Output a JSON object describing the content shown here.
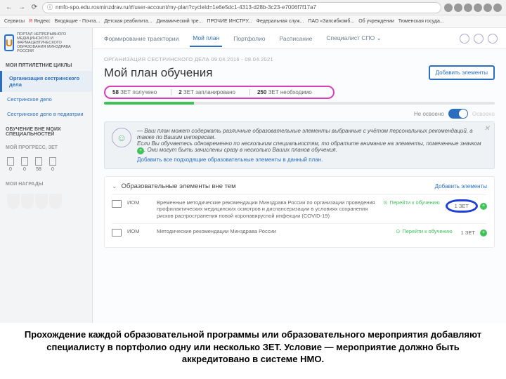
{
  "browser": {
    "url": "nmfo-spo.edu.rosminzdrav.ru/#/user-account/my-plan?cycleId=1e6e5dc1-4313-d28b-3c23-e7006f7f17a7",
    "bookmarks": [
      "Сервисы",
      "Яндекс",
      "Входящие - Почта...",
      "Детская реабилита...",
      "Динамический тре...",
      "ПРОЧИЕ ИНСТРУ...",
      "Федеральная служ...",
      "ПАО «Запсибкомб...",
      "Об учреждении",
      "Тюменская госуда..."
    ]
  },
  "logo_text": "ПОРТАЛ НЕПРЕРЫВНОГО МЕДИЦИНСКОГО И ФАРМАЦЕВТИЧЕСКОГО ОБРАЗОВАНИЯ МИНЗДРАВА РОССИИ",
  "tabs": [
    "Формирование траектории",
    "Мой план",
    "Портфолио",
    "Расписание",
    "Специалист СПО"
  ],
  "active_tab": 1,
  "sidebar": {
    "head1": "МОИ ПЯТИЛЕТНИЕ ЦИКЛЫ",
    "items": [
      "Организация сестринского дела",
      "Сестринское дело",
      "Сестринское дело в педиатрии"
    ],
    "head2": "ОБУЧЕНИЕ ВНЕ МОИХ СПЕЦИАЛЬНОСТЕЙ",
    "head3": "МОЙ ПРОГРЕСС, ЗЕТ",
    "progress": [
      "0",
      "0",
      "58",
      "0"
    ],
    "head4": "МОИ НАГРАДЫ"
  },
  "dates": "ОРГАНИЗАЦИЯ СЕСТРИНСКОГО ДЕЛА 09.04.2016 - 08.04.2021",
  "title": "Мой план обучения",
  "add_button": "Добавить элементы",
  "stats": {
    "got_n": "58",
    "got_t": "ЗЕТ получено",
    "plan_n": "2",
    "plan_t": "ЗЕТ запланировано",
    "need_n": "250",
    "need_t": "ЗЕТ необходимо"
  },
  "toggle": {
    "off": "Не освоено",
    "on": "Освоено"
  },
  "hint": {
    "line1": "— Ваш план может содержать различные образовательные элементы выбранные с учётом персональных рекомендаций, а также по Вашим интересам.",
    "line2a": "Если Вы обучаетесь одновременно по нескольким специальностям, то обратите внимание на элементы, помеченные значком ",
    "line2b": ". Они могут быть зачислены сразу в несколько Ваших планов обучения.",
    "link": "Добавить все подходящие образовательные элементы в данный план."
  },
  "section": {
    "title": "Образовательные элементы вне тем",
    "add": "Добавить элементы",
    "rows": [
      {
        "type": "ИОМ",
        "title": "Временные методические рекомендации Минздрава России по организации проведения профилактических медицинских осмотров и диспансеризации в условиях сохранения рисков распространения новой коронавирусной инфекции (COVID-19)",
        "action": "Перейти к обучению",
        "zet": "1  ЗЕТ",
        "ring": true
      },
      {
        "type": "ИОМ",
        "title": "Методические рекомендации Минздрава России",
        "action": "Перейти к обучению",
        "zet": "1  ЗЕТ",
        "ring": false
      }
    ]
  },
  "caption": "Прохождение каждой образовательной программы или образовательного мероприятия добавляют специалисту в портфолио одну или несколько ЗЕТ. Условие — мероприятие должно быть аккредитовано в системе НМО."
}
